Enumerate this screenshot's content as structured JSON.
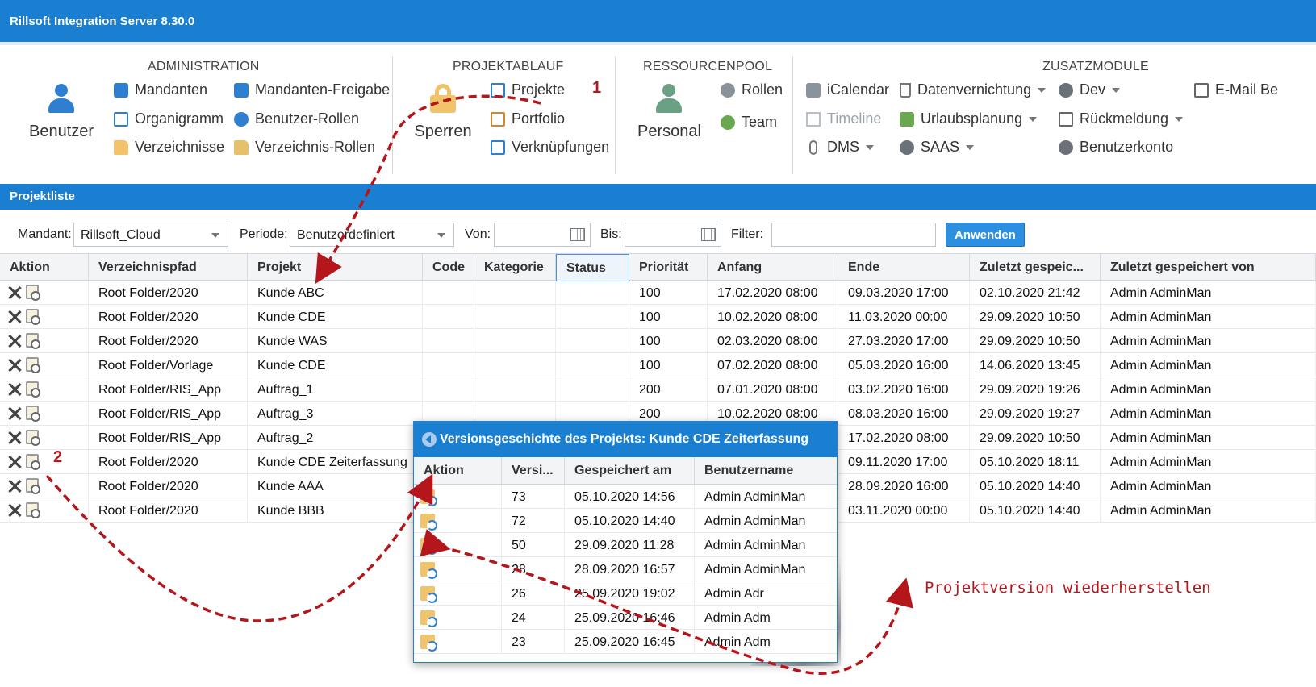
{
  "app": {
    "title": "Rillsoft Integration Server 8.30.0"
  },
  "ribbon": {
    "groups": {
      "administration": "ADMINISTRATION",
      "projektablauf": "PROJEKTABLAUF",
      "ressourcenpool": "RESSOURCENPOOL",
      "zusatzmodule": "ZUSATZMODULE"
    },
    "benutzer": "Benutzer",
    "mandanten": "Mandanten",
    "organigramm": "Organigramm",
    "verzeichnisse": "Verzeichnisse",
    "mandanten_freigabe": "Mandanten-Freigabe",
    "benutzer_rollen": "Benutzer-Rollen",
    "verzeichnis_rollen": "Verzeichnis-Rollen",
    "sperren": "Sperren",
    "projekte": "Projekte",
    "portfolio": "Portfolio",
    "verknuepfungen": "Verknüpfungen",
    "personal": "Personal",
    "rollen": "Rollen",
    "team": "Team",
    "icalendar": "iCalendar",
    "timeline": "Timeline",
    "dms": "DMS",
    "datenvernichtung": "Datenvernichtung",
    "urlaubsplanung": "Urlaubsplanung",
    "saas": "SAAS",
    "dev": "Dev",
    "rueckmeldung": "Rückmeldung",
    "benutzerkonto": "Benutzerkonto",
    "email": "E-Mail Be"
  },
  "section": {
    "title": "Projektliste"
  },
  "filters": {
    "mandant_label": "Mandant:",
    "mandant_value": "Rillsoft_Cloud",
    "periode_label": "Periode:",
    "periode_value": "Benutzerdefiniert",
    "von_label": "Von:",
    "von_value": "",
    "bis_label": "Bis:",
    "bis_value": "",
    "filter_label": "Filter:",
    "filter_value": "",
    "apply_label": "Anwenden"
  },
  "grid": {
    "columns": [
      "Aktion",
      "Verzeichnispfad",
      "Projekt",
      "Code",
      "Kategorie",
      "Status",
      "Priorität",
      "Anfang",
      "Ende",
      "Zuletzt gespeic...",
      "Zuletzt gespeichert von"
    ],
    "rows": [
      [
        "",
        "Root Folder/2020",
        "Kunde ABC",
        "",
        "",
        "",
        "100",
        "17.02.2020 08:00",
        "09.03.2020 17:00",
        "02.10.2020 21:42",
        "Admin AdminMan"
      ],
      [
        "",
        "Root Folder/2020",
        "Kunde CDE",
        "",
        "",
        "",
        "100",
        "10.02.2020 08:00",
        "11.03.2020 00:00",
        "29.09.2020 10:50",
        "Admin AdminMan"
      ],
      [
        "",
        "Root Folder/2020",
        "Kunde WAS",
        "",
        "",
        "",
        "100",
        "02.03.2020 08:00",
        "27.03.2020 17:00",
        "29.09.2020 10:50",
        "Admin AdminMan"
      ],
      [
        "",
        "Root Folder/Vorlage",
        "Kunde CDE",
        "",
        "",
        "",
        "100",
        "07.02.2020 08:00",
        "05.03.2020 16:00",
        "14.06.2020 13:45",
        "Admin AdminMan"
      ],
      [
        "",
        "Root Folder/RIS_App",
        "Auftrag_1",
        "",
        "",
        "",
        "200",
        "07.01.2020 08:00",
        "03.02.2020 16:00",
        "29.09.2020 19:26",
        "Admin AdminMan"
      ],
      [
        "",
        "Root Folder/RIS_App",
        "Auftrag_3",
        "",
        "",
        "",
        "200",
        "10.02.2020 08:00",
        "08.03.2020 16:00",
        "29.09.2020 19:27",
        "Admin AdminMan"
      ],
      [
        "",
        "Root Folder/RIS_App",
        "Auftrag_2",
        "",
        "",
        "",
        "",
        "",
        "17.02.2020 08:00",
        "29.09.2020 10:50",
        "Admin AdminMan"
      ],
      [
        "",
        "Root Folder/2020",
        "Kunde CDE Zeiterfassung",
        "",
        "",
        "",
        "",
        "",
        "09.11.2020 17:00",
        "05.10.2020 18:11",
        "Admin AdminMan"
      ],
      [
        "",
        "Root Folder/2020",
        "Kunde AAA",
        "",
        "",
        "",
        "",
        "",
        "28.09.2020 16:00",
        "05.10.2020 14:40",
        "Admin AdminMan"
      ],
      [
        "",
        "Root Folder/2020",
        "Kunde BBB",
        "",
        "",
        "",
        "",
        "",
        "03.11.2020 00:00",
        "05.10.2020 14:40",
        "Admin AdminMan"
      ]
    ]
  },
  "popup": {
    "title": "Versionsgeschichte des Projekts: Kunde CDE Zeiterfassung",
    "columns": [
      "Aktion",
      "Versi...",
      "Gespeichert am",
      "Benutzername"
    ],
    "rows": [
      [
        "",
        "73",
        "05.10.2020 14:56",
        "Admin AdminMan"
      ],
      [
        "",
        "72",
        "05.10.2020 14:40",
        "Admin AdminMan"
      ],
      [
        "",
        "50",
        "29.09.2020 11:28",
        "Admin AdminMan"
      ],
      [
        "",
        "28",
        "28.09.2020 16:57",
        "Admin AdminMan"
      ],
      [
        "",
        "26",
        "25.09.2020 19:02",
        "Admin Adr"
      ],
      [
        "",
        "24",
        "25.09.2020 16:46",
        "Admin Adm"
      ],
      [
        "",
        "23",
        "25.09.2020 16:45",
        "Admin Adm"
      ]
    ]
  },
  "annotations": {
    "step1": "1",
    "step2": "2",
    "restore_text": "Projektversion wiederherstellen"
  },
  "colors": {
    "accent": "#1a7fd1",
    "annotation": "#b5161b"
  }
}
